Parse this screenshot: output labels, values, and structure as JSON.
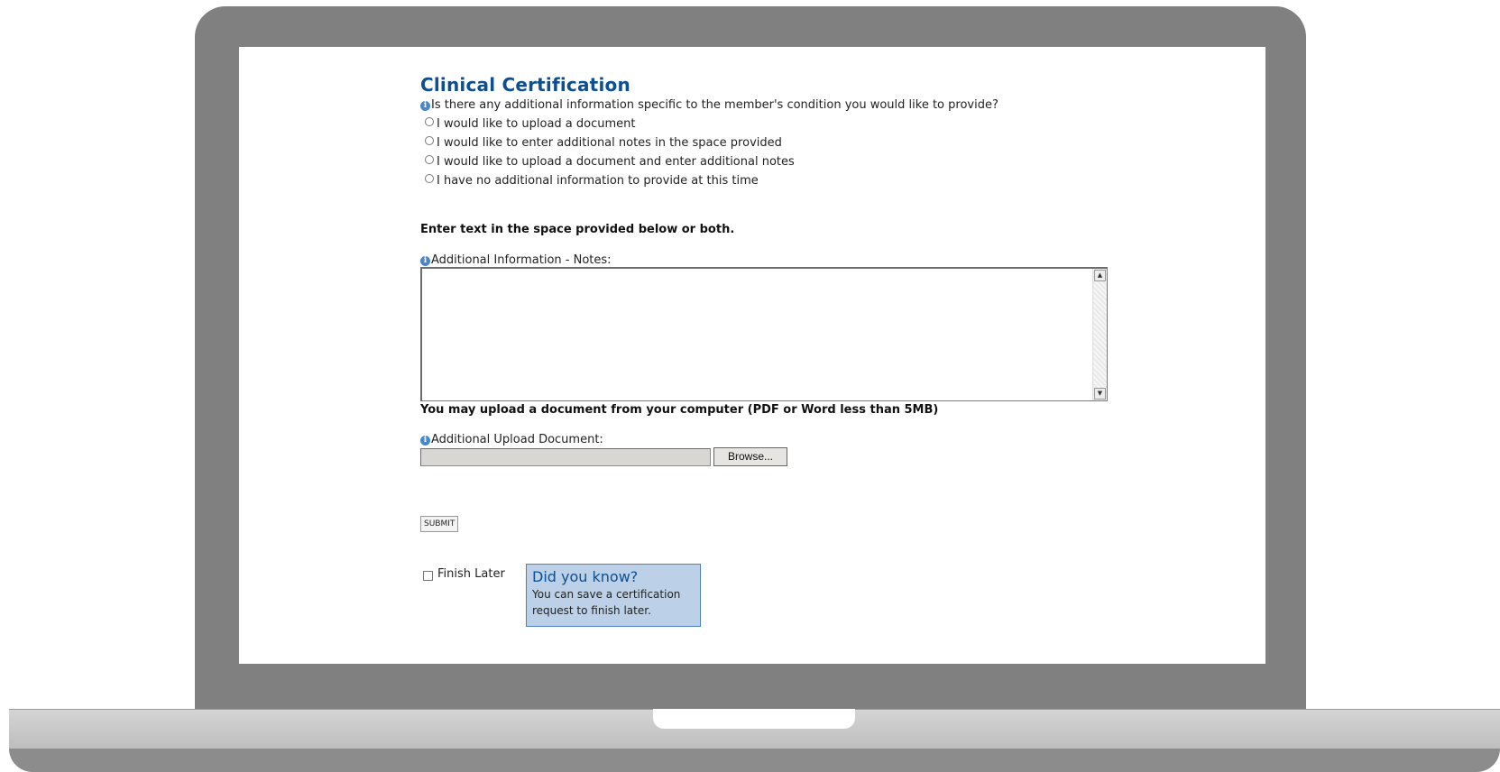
{
  "form": {
    "title": "Clinical Certification",
    "question": "Is there any additional information specific to the member's condition you would like to provide?",
    "options": [
      "I would like to upload a document",
      "I would like to enter additional notes in the space provided",
      "I would like to upload a document and enter additional notes",
      "I have no additional information to provide at this time"
    ],
    "enter_text_instruction": "Enter text in the space provided below or both.",
    "notes_label": "Additional Information - Notes:",
    "notes_value": "",
    "upload_instruction": "You may upload a document from your computer (PDF or Word less than 5MB)",
    "upload_label": "Additional Upload Document:",
    "browse_label": "Browse...",
    "submit_label": "SUBMIT",
    "finish_later_label": "Finish Later",
    "tip": {
      "title": "Did you know?",
      "body": "You can save a certification request to finish later."
    }
  },
  "colors": {
    "title": "#0d4f91",
    "tip_background": "#bcd0e8",
    "frame": "#808080"
  },
  "icons": {
    "info": "info-circle-icon"
  }
}
